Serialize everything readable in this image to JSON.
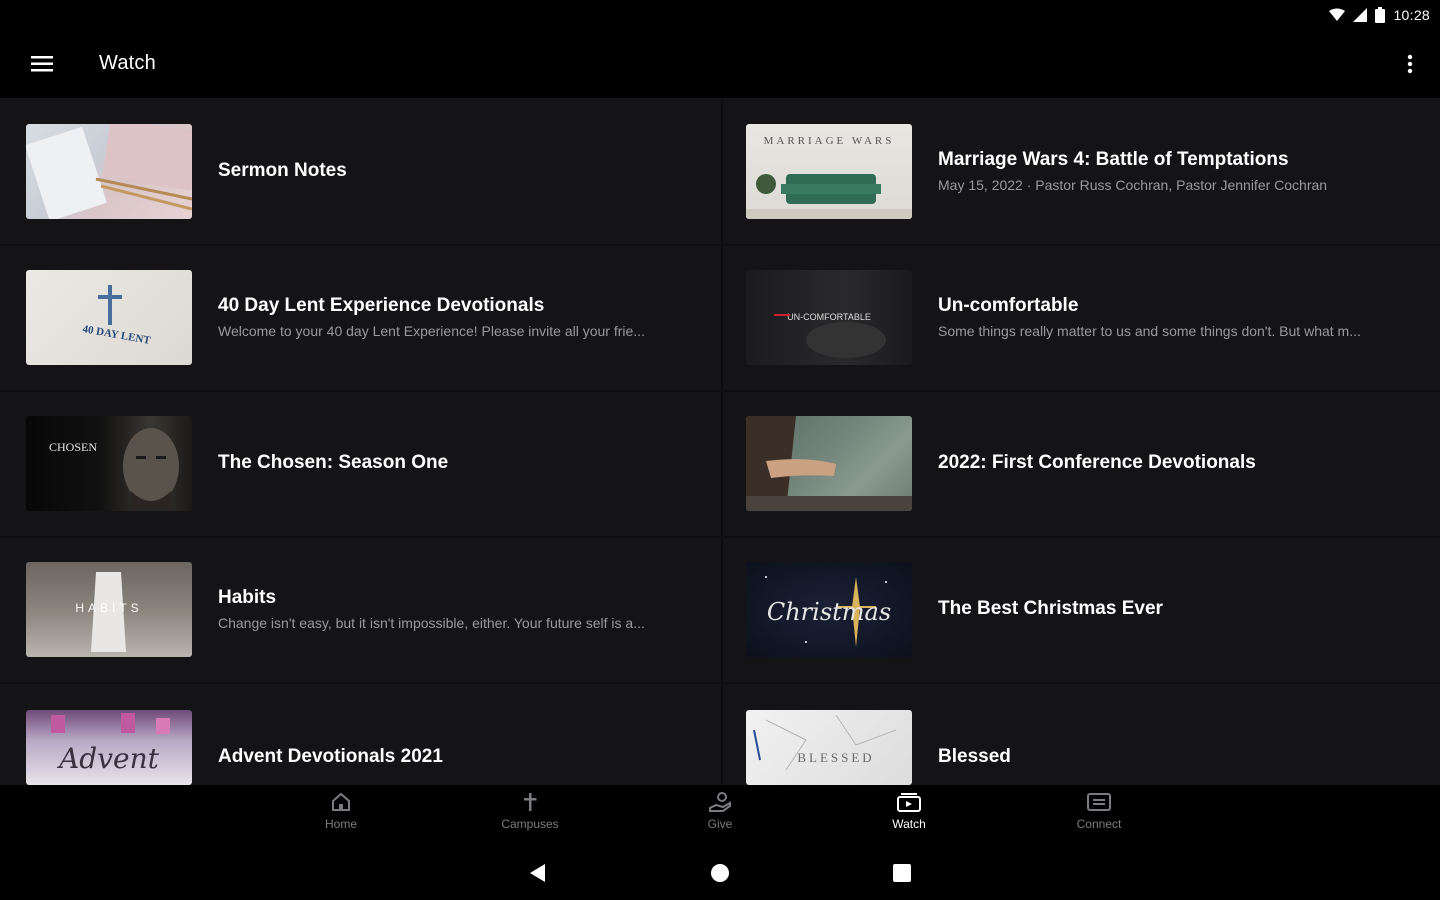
{
  "status_bar": {
    "time": "10:28",
    "icons": [
      "wifi-icon",
      "signal-icon",
      "battery-icon"
    ]
  },
  "app_bar": {
    "title": "Watch",
    "menu_icon": "hamburger-menu-icon",
    "more_icon": "more-vertical-icon"
  },
  "items": [
    {
      "title": "Sermon Notes",
      "subtitle": "",
      "thumb": "sermon-notes-thumbnail"
    },
    {
      "title": "Marriage Wars 4: Battle of Temptations",
      "subtitle": "May 15, 2022 · Pastor Russ Cochran, Pastor Jennifer Cochran",
      "thumb": "marriage-wars-thumbnail",
      "thumb_text": "MARRIAGE WARS"
    },
    {
      "title": "40 Day Lent Experience Devotionals",
      "subtitle": "Welcome to your 40 day Lent Experience! Please invite all your frie...",
      "thumb": "lent-thumbnail",
      "thumb_text": "40 DAY LENT"
    },
    {
      "title": "Un-comfortable",
      "subtitle": "Some things really matter to us and some things don't. But what m...",
      "thumb": "uncomfortable-thumbnail",
      "thumb_text": "UN-COMFORTABLE"
    },
    {
      "title": "The Chosen: Season One",
      "subtitle": "",
      "thumb": "the-chosen-thumbnail",
      "thumb_text": "CHOSEN"
    },
    {
      "title": "2022: First Conference Devotionals",
      "subtitle": "",
      "thumb": "conference-thumbnail"
    },
    {
      "title": "Habits",
      "subtitle": "Change isn't easy, but it isn't impossible, either. Your future self is a...",
      "thumb": "habits-thumbnail",
      "thumb_text": "HABITS"
    },
    {
      "title": "The Best Christmas Ever",
      "subtitle": "",
      "thumb": "christmas-thumbnail",
      "thumb_text": "Christmas"
    },
    {
      "title": "Advent Devotionals 2021",
      "subtitle": "",
      "thumb": "advent-thumbnail",
      "thumb_text": "Advent"
    },
    {
      "title": "Blessed",
      "subtitle": "",
      "thumb": "blessed-thumbnail",
      "thumb_text": "BLESSED"
    }
  ],
  "bottom_nav": [
    {
      "label": "Home",
      "icon": "home-icon",
      "active": false
    },
    {
      "label": "Campuses",
      "icon": "cross-icon",
      "active": false
    },
    {
      "label": "Give",
      "icon": "give-icon",
      "active": false
    },
    {
      "label": "Watch",
      "icon": "watch-icon",
      "active": true
    },
    {
      "label": "Connect",
      "icon": "connect-icon",
      "active": false
    }
  ],
  "system_nav": [
    "back-icon",
    "home-circle-icon",
    "recents-icon"
  ]
}
